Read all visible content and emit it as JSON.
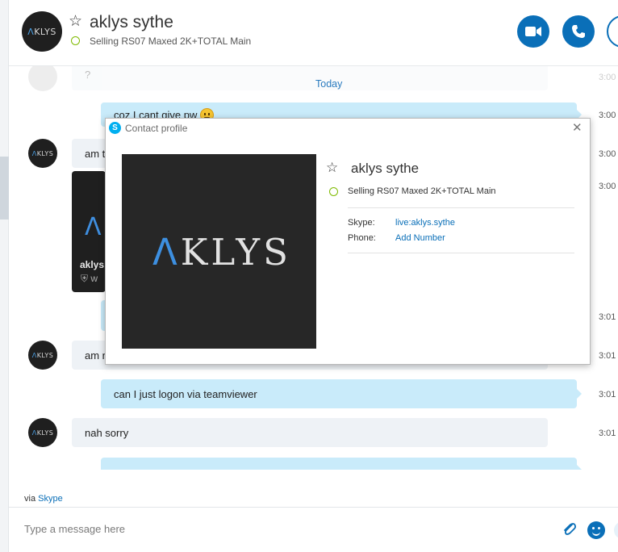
{
  "header": {
    "avatar_text": "KLYS",
    "avatar_a": "Λ",
    "star": "☆",
    "contact_name": "aklys sythe",
    "mood": "Selling RS07 Maxed 2K+TOTAL Main",
    "video_icon": "video-camera-icon",
    "call_icon": "phone-icon",
    "add_icon": "add-person-icon"
  },
  "chat": {
    "prev_time": "3:00",
    "prev_text": "?",
    "today_label": "Today",
    "messages": [
      {
        "text": "coz I cant give pw",
        "time": "3:00"
      },
      {
        "text": "am t",
        "time": "3:00"
      },
      {
        "time": "3:00"
      },
      {
        "text": "",
        "time": "3:01"
      },
      {
        "text": "am n",
        "time": "3:01"
      },
      {
        "text": "can I just logon via teamviewer",
        "time": "3:01"
      },
      {
        "text": "nah sorry",
        "time": "3:01"
      }
    ],
    "card": {
      "title": "aklys",
      "shield_text": "w",
      "logo_a": "Λ"
    }
  },
  "footer": {
    "via_label": "via",
    "via_link": "Skype",
    "composer_placeholder": "Type a message here"
  },
  "dialog": {
    "title": "Contact profile",
    "skype_glyph": "S",
    "close_glyph": "✕",
    "photo_brand_a": "Λ",
    "photo_brand_rest": "KLYS",
    "star": "☆",
    "name": "aklys sythe",
    "mood": "Selling RS07 Maxed 2K+TOTAL Main",
    "skype_label": "Skype:",
    "skype_value": "live:aklys.sythe",
    "phone_label": "Phone:",
    "phone_value": "Add Number"
  },
  "colors": {
    "accent": "#0a6fb8",
    "outgoing_bubble": "#c9ebfa",
    "incoming_bubble": "#eef2f6",
    "presence": "#7fba00"
  }
}
